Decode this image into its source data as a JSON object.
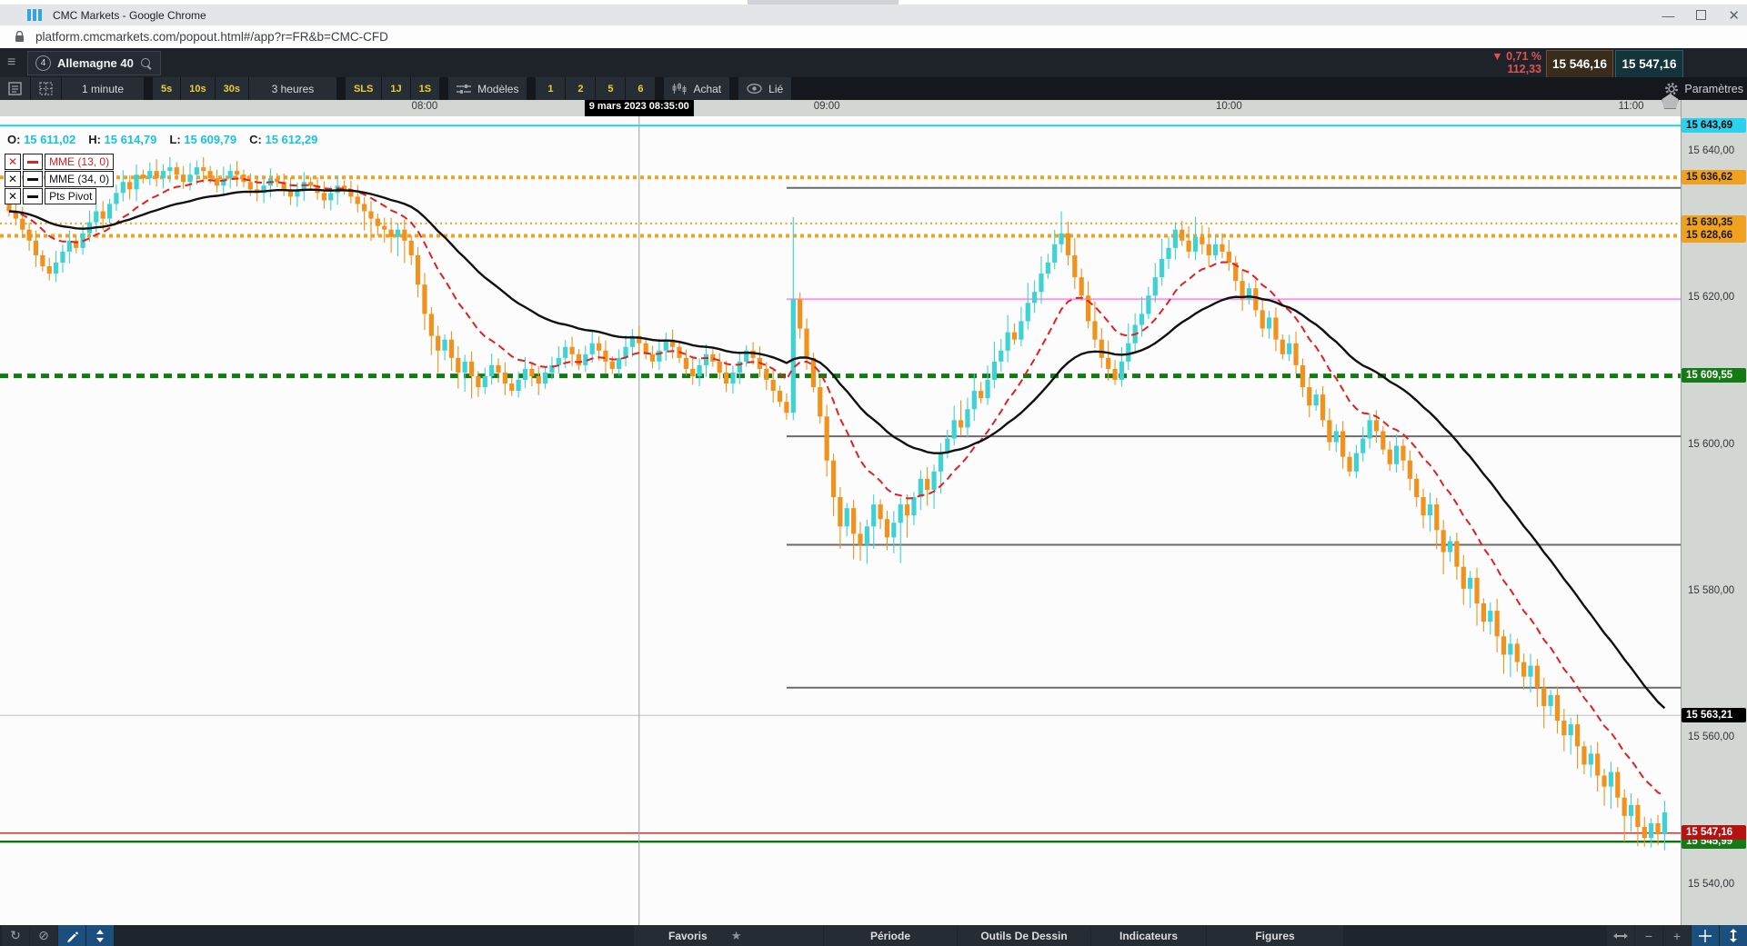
{
  "browser": {
    "title": "CMC Markets - Google Chrome",
    "url": "platform.cmcmarkets.com/popout.html#/app?r=FR&b=CMC-CFD"
  },
  "header": {
    "instrument_number": "4",
    "instrument": "Allemagne 40",
    "change_percent": "0,71 %",
    "change_value": "112,33",
    "sell_price": "15 546,16",
    "buy_price": "15 547,16",
    "spread": "-",
    "settings_label": "Paramètres"
  },
  "toolbar": {
    "interval": "1 minute",
    "quick": [
      "5s",
      "10s",
      "30s"
    ],
    "range": "3 heures",
    "ranges": [
      "SLS",
      "1J",
      "1S"
    ],
    "models_label": "Modèles",
    "model_numbers": [
      "1",
      "2",
      "5",
      "6"
    ],
    "buy_label": "Achat",
    "linked_label": "Lié"
  },
  "ohlc": {
    "o_label": "O:",
    "o": "15 611,02",
    "h_label": "H:",
    "h": "15 614,79",
    "l_label": "L:",
    "l": "15 609,79",
    "c_label": "C:",
    "c": "15 612,29"
  },
  "indicators": [
    {
      "label": "MME (13, 0)",
      "color": "#e02020"
    },
    {
      "label": "MME (34, 0)",
      "color": "#111111"
    },
    {
      "label": "Pts Pivot",
      "color": "#111111"
    }
  ],
  "bottom_bar": {
    "favoris": "Favoris",
    "periode": "Période",
    "outils": "Outils De Dessin",
    "indicateurs": "Indicateurs",
    "figures": "Figures"
  },
  "chart_data": {
    "type": "candlestick",
    "symbol": "Allemagne 40",
    "interval": "1 minute",
    "date": "9 mars 2023",
    "crosshair": {
      "tooltip": "9 mars 2023 08:35:00",
      "minute": 94
    },
    "up_color": "#3fd2d2",
    "down_color": "#f0921e",
    "ema13_color": "#e61e1e",
    "ema34_color": "#101010",
    "x_ticks": [
      {
        "label": "08:00",
        "minute": 62
      },
      {
        "label": "09:00",
        "minute": 122
      },
      {
        "label": "10:00",
        "minute": 182
      },
      {
        "label": "11:00",
        "minute": 242
      }
    ],
    "y_ticks": [
      {
        "label": "15 640,00",
        "value": 15640
      },
      {
        "label": "15 620,00",
        "value": 15620
      },
      {
        "label": "15 600,00",
        "value": 15600
      },
      {
        "label": "15 580,00",
        "value": 15580
      },
      {
        "label": "15 560,00",
        "value": 15560
      },
      {
        "label": "15 540,00",
        "value": 15540
      }
    ],
    "levels": [
      {
        "value": 15643.69,
        "label": "15 643,69",
        "color": "#1ad4ee",
        "style": "solid",
        "width": 2,
        "badge_bg": "#2ad2ee",
        "badge_fg": "#000",
        "z": 3
      },
      {
        "value": 15636.62,
        "label": "15 636,62",
        "color": "#f2a11c",
        "style": "dotted-thick",
        "width": 4,
        "badge_bg": "#f0a11f",
        "badge_fg": "#1a1a1a",
        "z": 3
      },
      {
        "value": 15635.2,
        "color": "#6b6b6b",
        "style": "solid",
        "width": 2,
        "from_min": 116
      },
      {
        "value": 15630.35,
        "label": "15 630,35",
        "color": "#f2a11c",
        "style": "dotted-thin",
        "width": 2,
        "badge_bg": "#f0a11f",
        "badge_fg": "#1a1a1a",
        "z": 3
      },
      {
        "value": 15628.66,
        "label": "15 628,66",
        "color": "#f2a11c",
        "style": "dotted-thick",
        "width": 4,
        "badge_bg": "#f0a11f",
        "badge_fg": "#1a1a1a",
        "z": 3
      },
      {
        "value": 15620.0,
        "color": "#f49ae8",
        "style": "solid",
        "width": 2,
        "from_min": 116
      },
      {
        "value": 15609.55,
        "label": "15 609,55",
        "color": "#117a11",
        "style": "dashed-thick",
        "width": 5,
        "badge_bg": "#157a15",
        "badge_fg": "#fff",
        "z": 3
      },
      {
        "value": 15601.3,
        "color": "#6b6b6b",
        "style": "solid",
        "width": 2,
        "from_min": 116
      },
      {
        "value": 15586.5,
        "color": "#6b6b6b",
        "style": "solid",
        "width": 2,
        "from_min": 116
      },
      {
        "value": 15567.0,
        "color": "#6b6b6b",
        "style": "solid",
        "width": 2,
        "from_min": 116
      },
      {
        "value": 15563.21,
        "label": "15 563,21",
        "color": "#c0c0c0",
        "style": "solid",
        "width": 1,
        "badge_bg": "#000000",
        "badge_fg": "#fff",
        "z": 4
      },
      {
        "value": 15547.16,
        "label": "15 547,16",
        "color": "#e02828",
        "style": "solid",
        "width": 1.4,
        "badge_bg": "#b51212",
        "badge_fg": "#fff",
        "z": 6
      },
      {
        "value": 15545.99,
        "label": "15 545,99",
        "color": "#067806",
        "style": "solid",
        "width": 2.4,
        "badge_bg": "#157a15",
        "badge_fg": "#fff",
        "z": 5
      }
    ],
    "first_open": 15633,
    "start_time": "06:58",
    "closes": [
      15632,
      15631,
      15629.5,
      15628,
      15626,
      15624.5,
      15623.5,
      15625,
      15626.5,
      15628,
      15627,
      15629,
      15630.5,
      15632,
      15631,
      15633,
      15634.5,
      15636,
      15635,
      15637,
      15636.5,
      15637.5,
      15636.5,
      15637.5,
      15638,
      15637,
      15636,
      15637,
      15638,
      15637.5,
      15636.5,
      15635.5,
      15636.5,
      15637.5,
      15637,
      15636,
      15635,
      15634.5,
      15635.5,
      15636.5,
      15636,
      15635,
      15634,
      15635,
      15636,
      15635.5,
      15634.5,
      15633.5,
      15634.5,
      15635.5,
      15635,
      15634,
      15633,
      15632,
      15631,
      15630,
      15629.5,
      15628.5,
      15629.5,
      15628,
      15626,
      15622,
      15618,
      15615,
      15613,
      15614.5,
      15612,
      15610,
      15611.5,
      15609.5,
      15608,
      15609.5,
      15611,
      15610,
      15608.5,
      15607.5,
      15609,
      15610.5,
      15609.5,
      15608.5,
      15610,
      15611,
      15612,
      15613.5,
      15612.5,
      15611,
      15612.5,
      15614,
      15613,
      15611.5,
      15610.5,
      15612,
      15613.5,
      15615,
      15614,
      15612.5,
      15611.5,
      15613,
      15614.5,
      15613.5,
      15612,
      15610.5,
      15609.5,
      15611,
      15612.5,
      15611.5,
      15610,
      15608.5,
      15610,
      15611.5,
      15613,
      15612,
      15610.5,
      15609,
      15607.5,
      15606,
      15604.5,
      15620,
      15616,
      15612,
      15608,
      15604,
      15598,
      15593,
      15589,
      15591.5,
      15588,
      15586.5,
      15589,
      15592,
      15590,
      15587.5,
      15589.5,
      15592,
      15590.5,
      15593,
      15595.5,
      15594,
      15596.5,
      15599,
      15601,
      15603.5,
      15602.5,
      15605,
      15607.5,
      15606.5,
      15609,
      15611.5,
      15613,
      15615.5,
      15614.5,
      15617,
      15619.5,
      15621,
      15623.5,
      15625,
      15627.5,
      15629,
      15626,
      15623,
      15620.5,
      15617,
      15614.5,
      15612,
      15610.5,
      15609,
      15611.5,
      15614,
      15616.5,
      15618,
      15620.5,
      15623,
      15625.5,
      15627,
      15629.5,
      15628,
      15626.5,
      15628.5,
      15627.5,
      15626,
      15627.5,
      15626.5,
      15625,
      15622.5,
      15620,
      15621.5,
      15618.5,
      15616,
      15617.5,
      15614.5,
      15612.5,
      15614,
      15611,
      15608,
      15605.5,
      15607,
      15603.5,
      15600.5,
      15602,
      15598.5,
      15596.5,
      15599,
      15601,
      15603.5,
      15602,
      15599.5,
      15597.5,
      15600,
      15598,
      15595.5,
      15593,
      15590.5,
      15592,
      15588.5,
      15585.5,
      15587,
      15583.5,
      15580.5,
      15582,
      15578.5,
      15576,
      15577.5,
      15574,
      15571.5,
      15573,
      15570.5,
      15568.5,
      15570,
      15567,
      15564.5,
      15566,
      15562.5,
      15560.5,
      15562,
      15559,
      15556.5,
      15558,
      15555,
      15553.5,
      15555.5,
      15552,
      15549.5,
      15551,
      15548,
      15546.5,
      15548.5,
      15547,
      15550
    ],
    "spikes": {
      "117": [
        15631.2,
        15603.5
      ],
      "126": [
        null,
        15584.5
      ],
      "133": [
        null,
        15584.0
      ],
      "157": [
        15632.0,
        null
      ],
      "174": [
        15630.5,
        null
      ],
      "181": [
        15629.0,
        null
      ],
      "241": [
        null,
        15546.0
      ],
      "244": [
        null,
        15545.3
      ],
      "246": [
        null,
        15545.5
      ]
    }
  }
}
